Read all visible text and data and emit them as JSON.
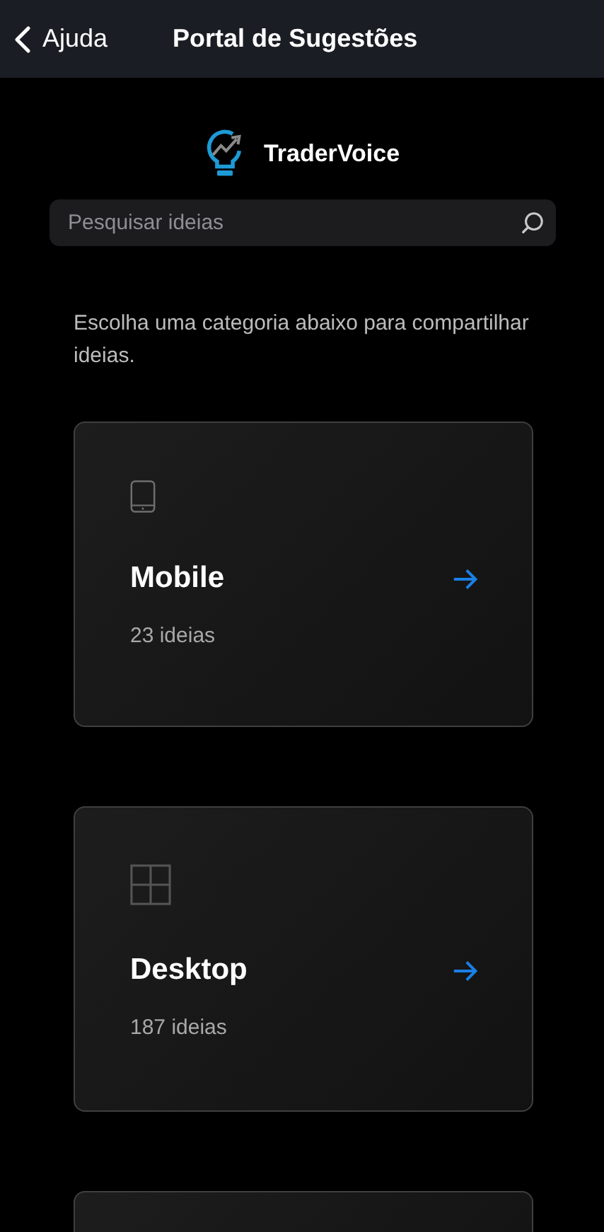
{
  "nav": {
    "back_label": "Ajuda",
    "title": "Portal de Sugestões"
  },
  "brand": {
    "name": "TraderVoice"
  },
  "search": {
    "placeholder": "Pesquisar ideias"
  },
  "intro": "Escolha uma categoria abaixo para compartilhar ideias.",
  "categories": [
    {
      "kind": "mobile",
      "title": "Mobile",
      "count": "23 ideias"
    },
    {
      "kind": "desktop",
      "title": "Desktop",
      "count": "187 ideias"
    }
  ]
}
